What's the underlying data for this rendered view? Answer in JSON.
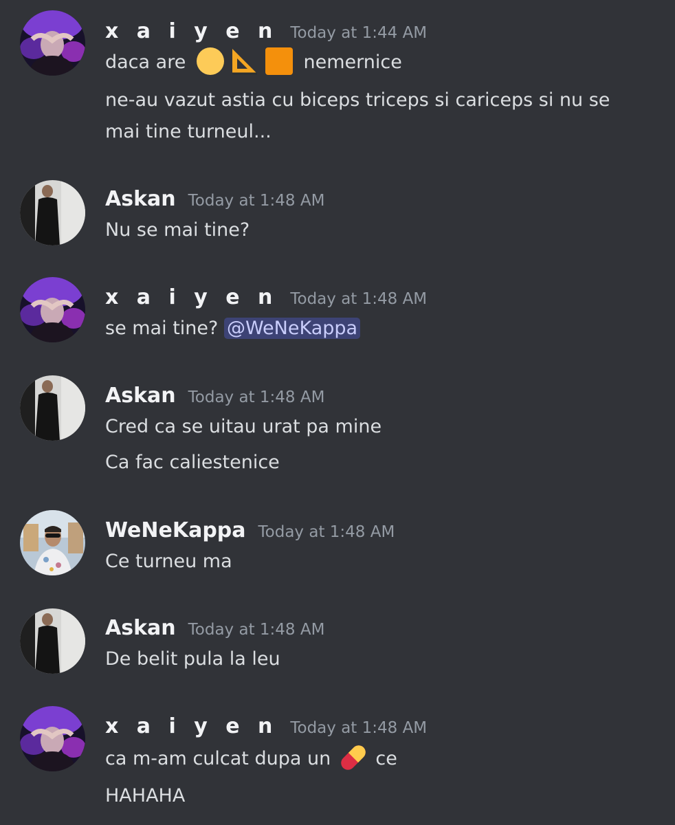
{
  "messages": [
    {
      "username": "x a i y e n",
      "timestamp": "Today at 1:44 AM",
      "line1_before": "daca are",
      "line1_after": "nemernice",
      "line2": "ne-au vazut astia cu biceps triceps si cariceps si nu se",
      "line3": "mai tine turneul...",
      "emojis": [
        "yellow-circle",
        "triangular-ruler",
        "orange-square"
      ]
    },
    {
      "username": "Askan",
      "timestamp": "Today at 1:48 AM",
      "line1": "Nu se mai tine?"
    },
    {
      "username": "x a i y e n",
      "timestamp": "Today at 1:48 AM",
      "line1": "se mai tine?",
      "mention": "@WeNeKappa"
    },
    {
      "username": "Askan",
      "timestamp": "Today at 1:48 AM",
      "line1": "Cred ca se uitau urat pa mine",
      "line2": "Ca fac caliestenice"
    },
    {
      "username": "WeNeKappa",
      "timestamp": "Today at 1:48 AM",
      "line1": "Ce turneu ma"
    },
    {
      "username": "Askan",
      "timestamp": "Today at 1:48 AM",
      "line1": "De belit pula la leu"
    },
    {
      "username": "x a i y e n",
      "timestamp": "Today at 1:48 AM",
      "line1_before": "ca m-am culcat dupa un",
      "line1_after": "ce",
      "line2": "HAHAHA",
      "emojis": [
        "pill"
      ]
    }
  ],
  "colors": {
    "background": "#313338",
    "username": "#f2f3f5",
    "timestamp": "#949ba4",
    "text": "#dbdee1",
    "mention_bg": "#3c4270",
    "mention_text": "#c9cdfb"
  }
}
